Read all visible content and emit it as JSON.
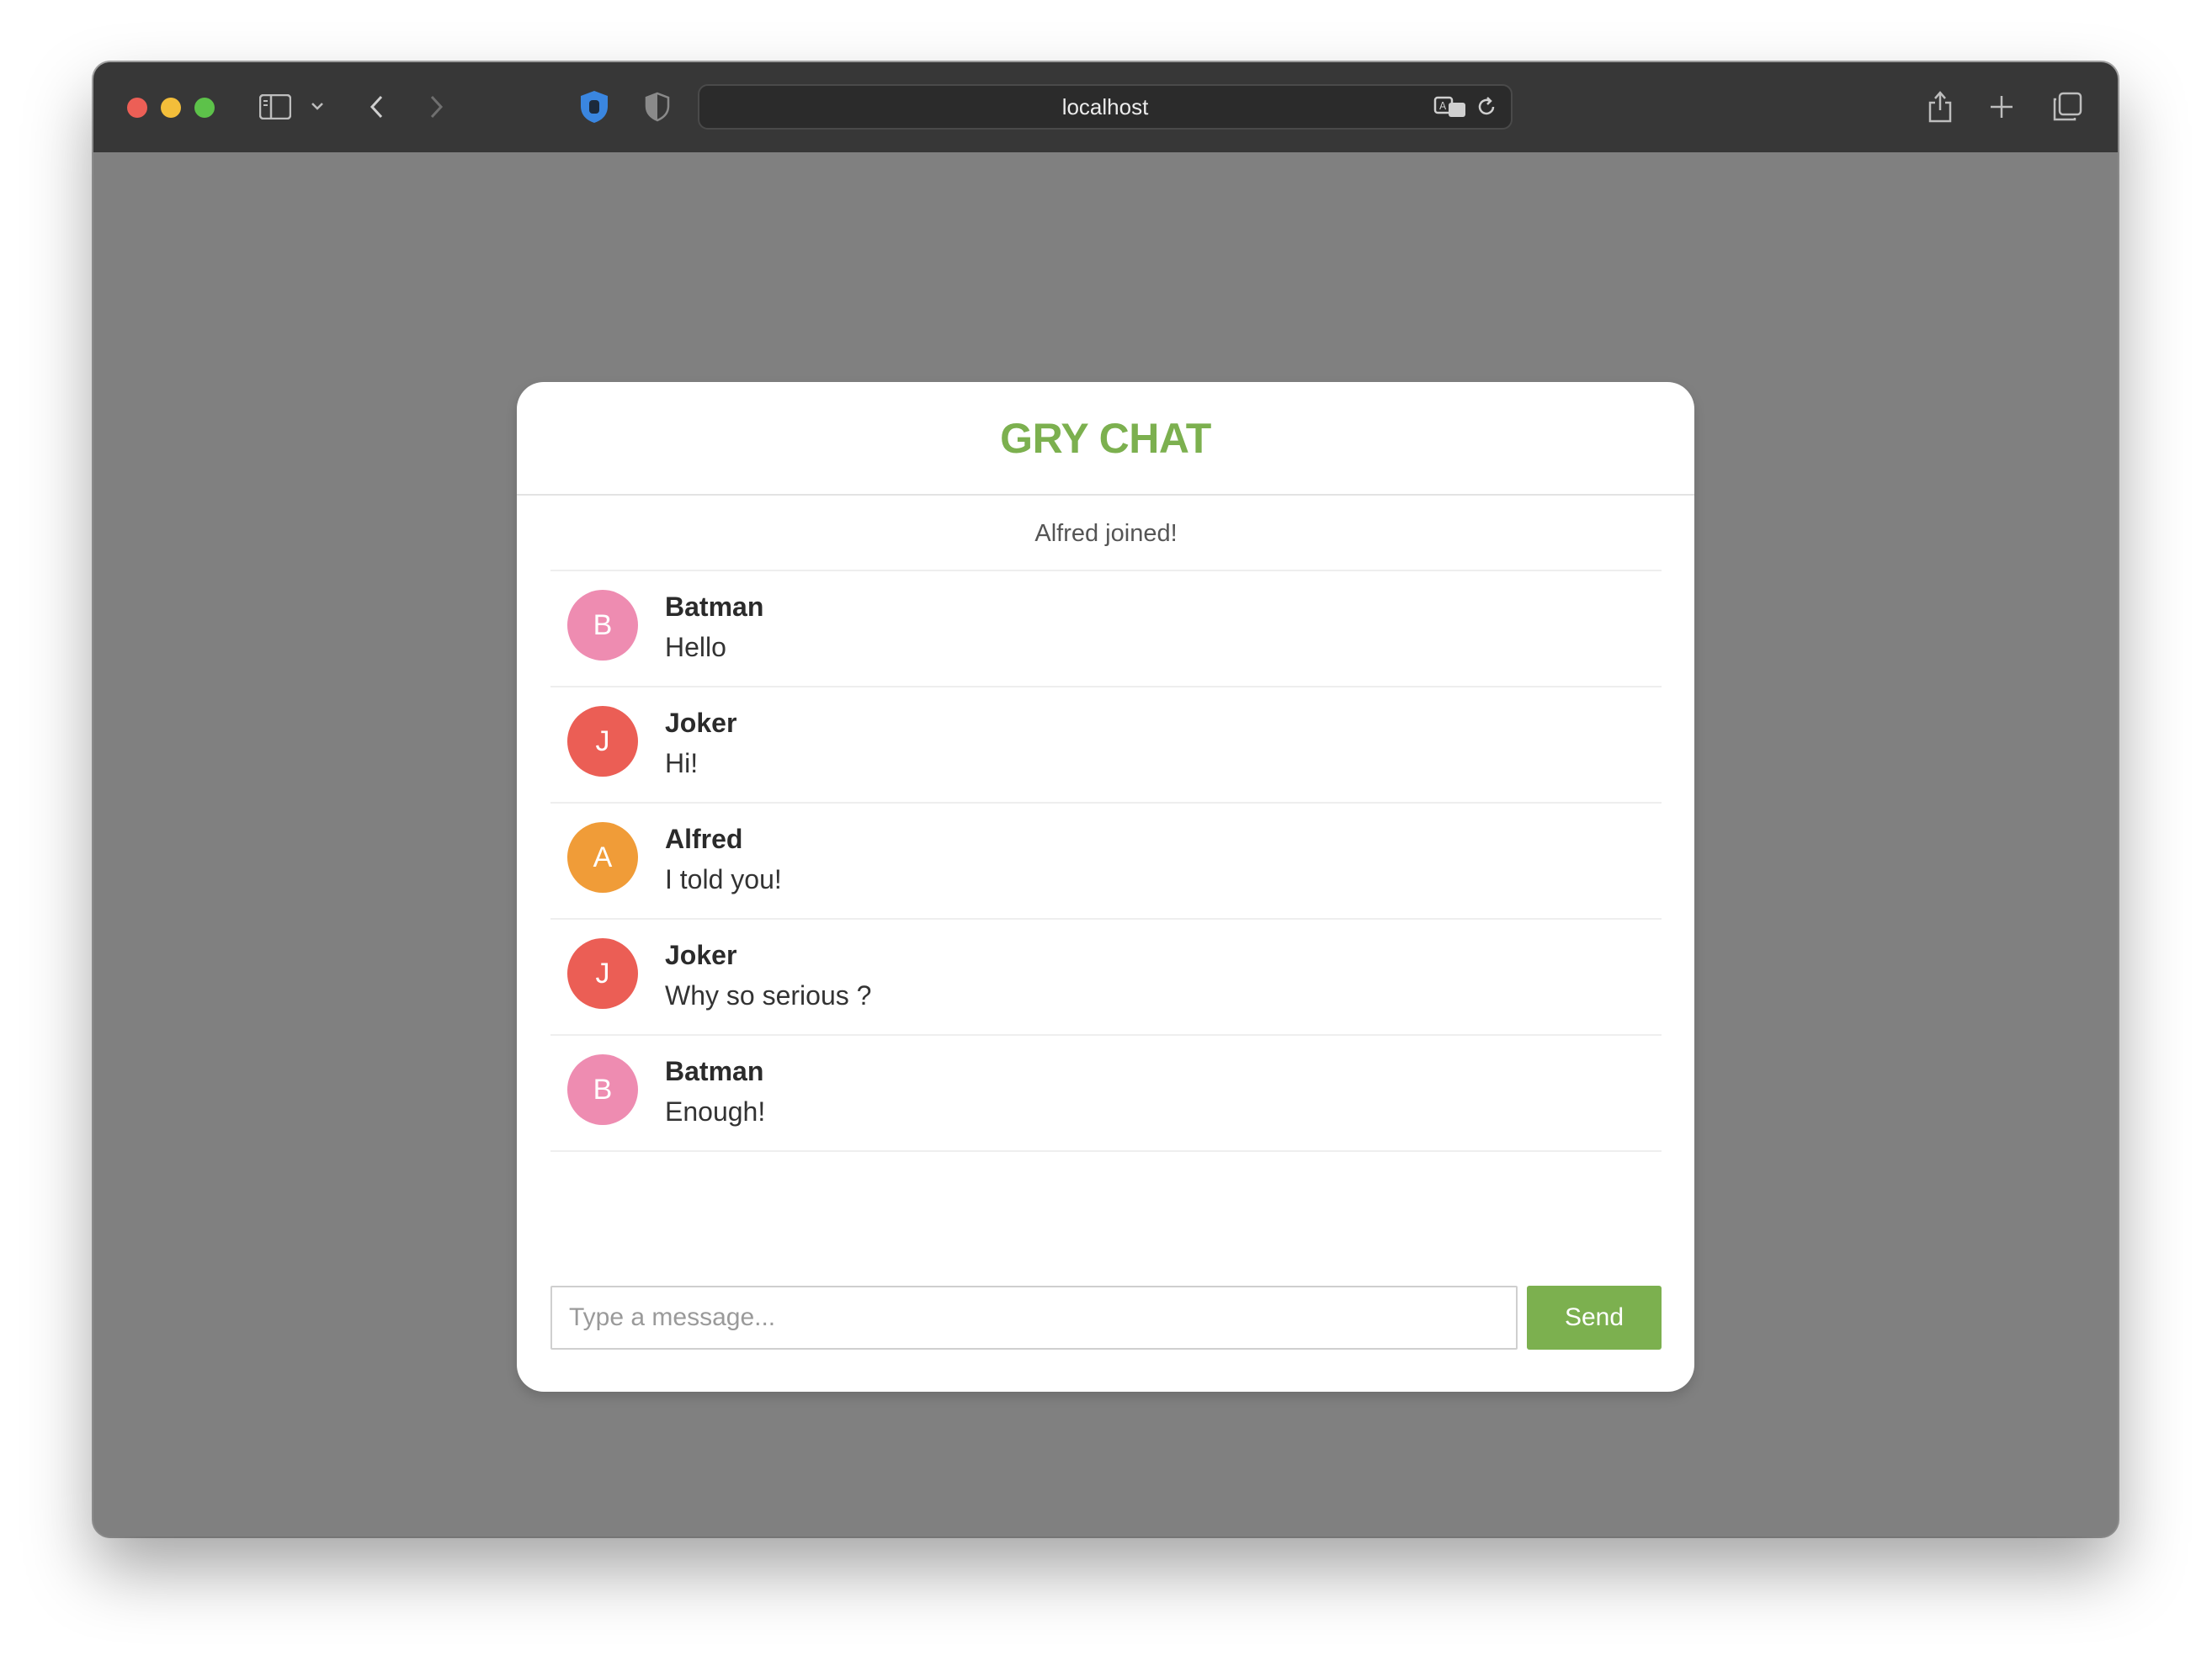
{
  "browser": {
    "url": "localhost",
    "icons": {
      "sidebar": "sidebar-icon",
      "chevron": "chevron-down-icon",
      "back": "back-icon",
      "forward": "forward-icon",
      "extension": "hand-shield-icon",
      "privacy": "privacy-shield-icon",
      "translate": "translate-icon",
      "reload": "reload-icon",
      "share": "share-icon",
      "new_tab": "plus-icon",
      "tabs": "tabs-overview-icon"
    }
  },
  "chat": {
    "title": "GRY CHAT",
    "title_color": "#7cb04f",
    "system_message": "Alfred joined!",
    "messages": [
      {
        "initial": "B",
        "name": "Batman",
        "text": "Hello",
        "color": "#ee8cb1"
      },
      {
        "initial": "J",
        "name": "Joker",
        "text": "Hi!",
        "color": "#eb5e55"
      },
      {
        "initial": "A",
        "name": "Alfred",
        "text": "I told you!",
        "color": "#f09c38"
      },
      {
        "initial": "J",
        "name": "Joker",
        "text": "Why so serious ?",
        "color": "#eb5e55"
      },
      {
        "initial": "B",
        "name": "Batman",
        "text": "Enough!",
        "color": "#ee8cb1"
      }
    ],
    "input": {
      "placeholder": "Type a message...",
      "value": ""
    },
    "send_label": "Send",
    "send_color": "#7cb04f"
  }
}
